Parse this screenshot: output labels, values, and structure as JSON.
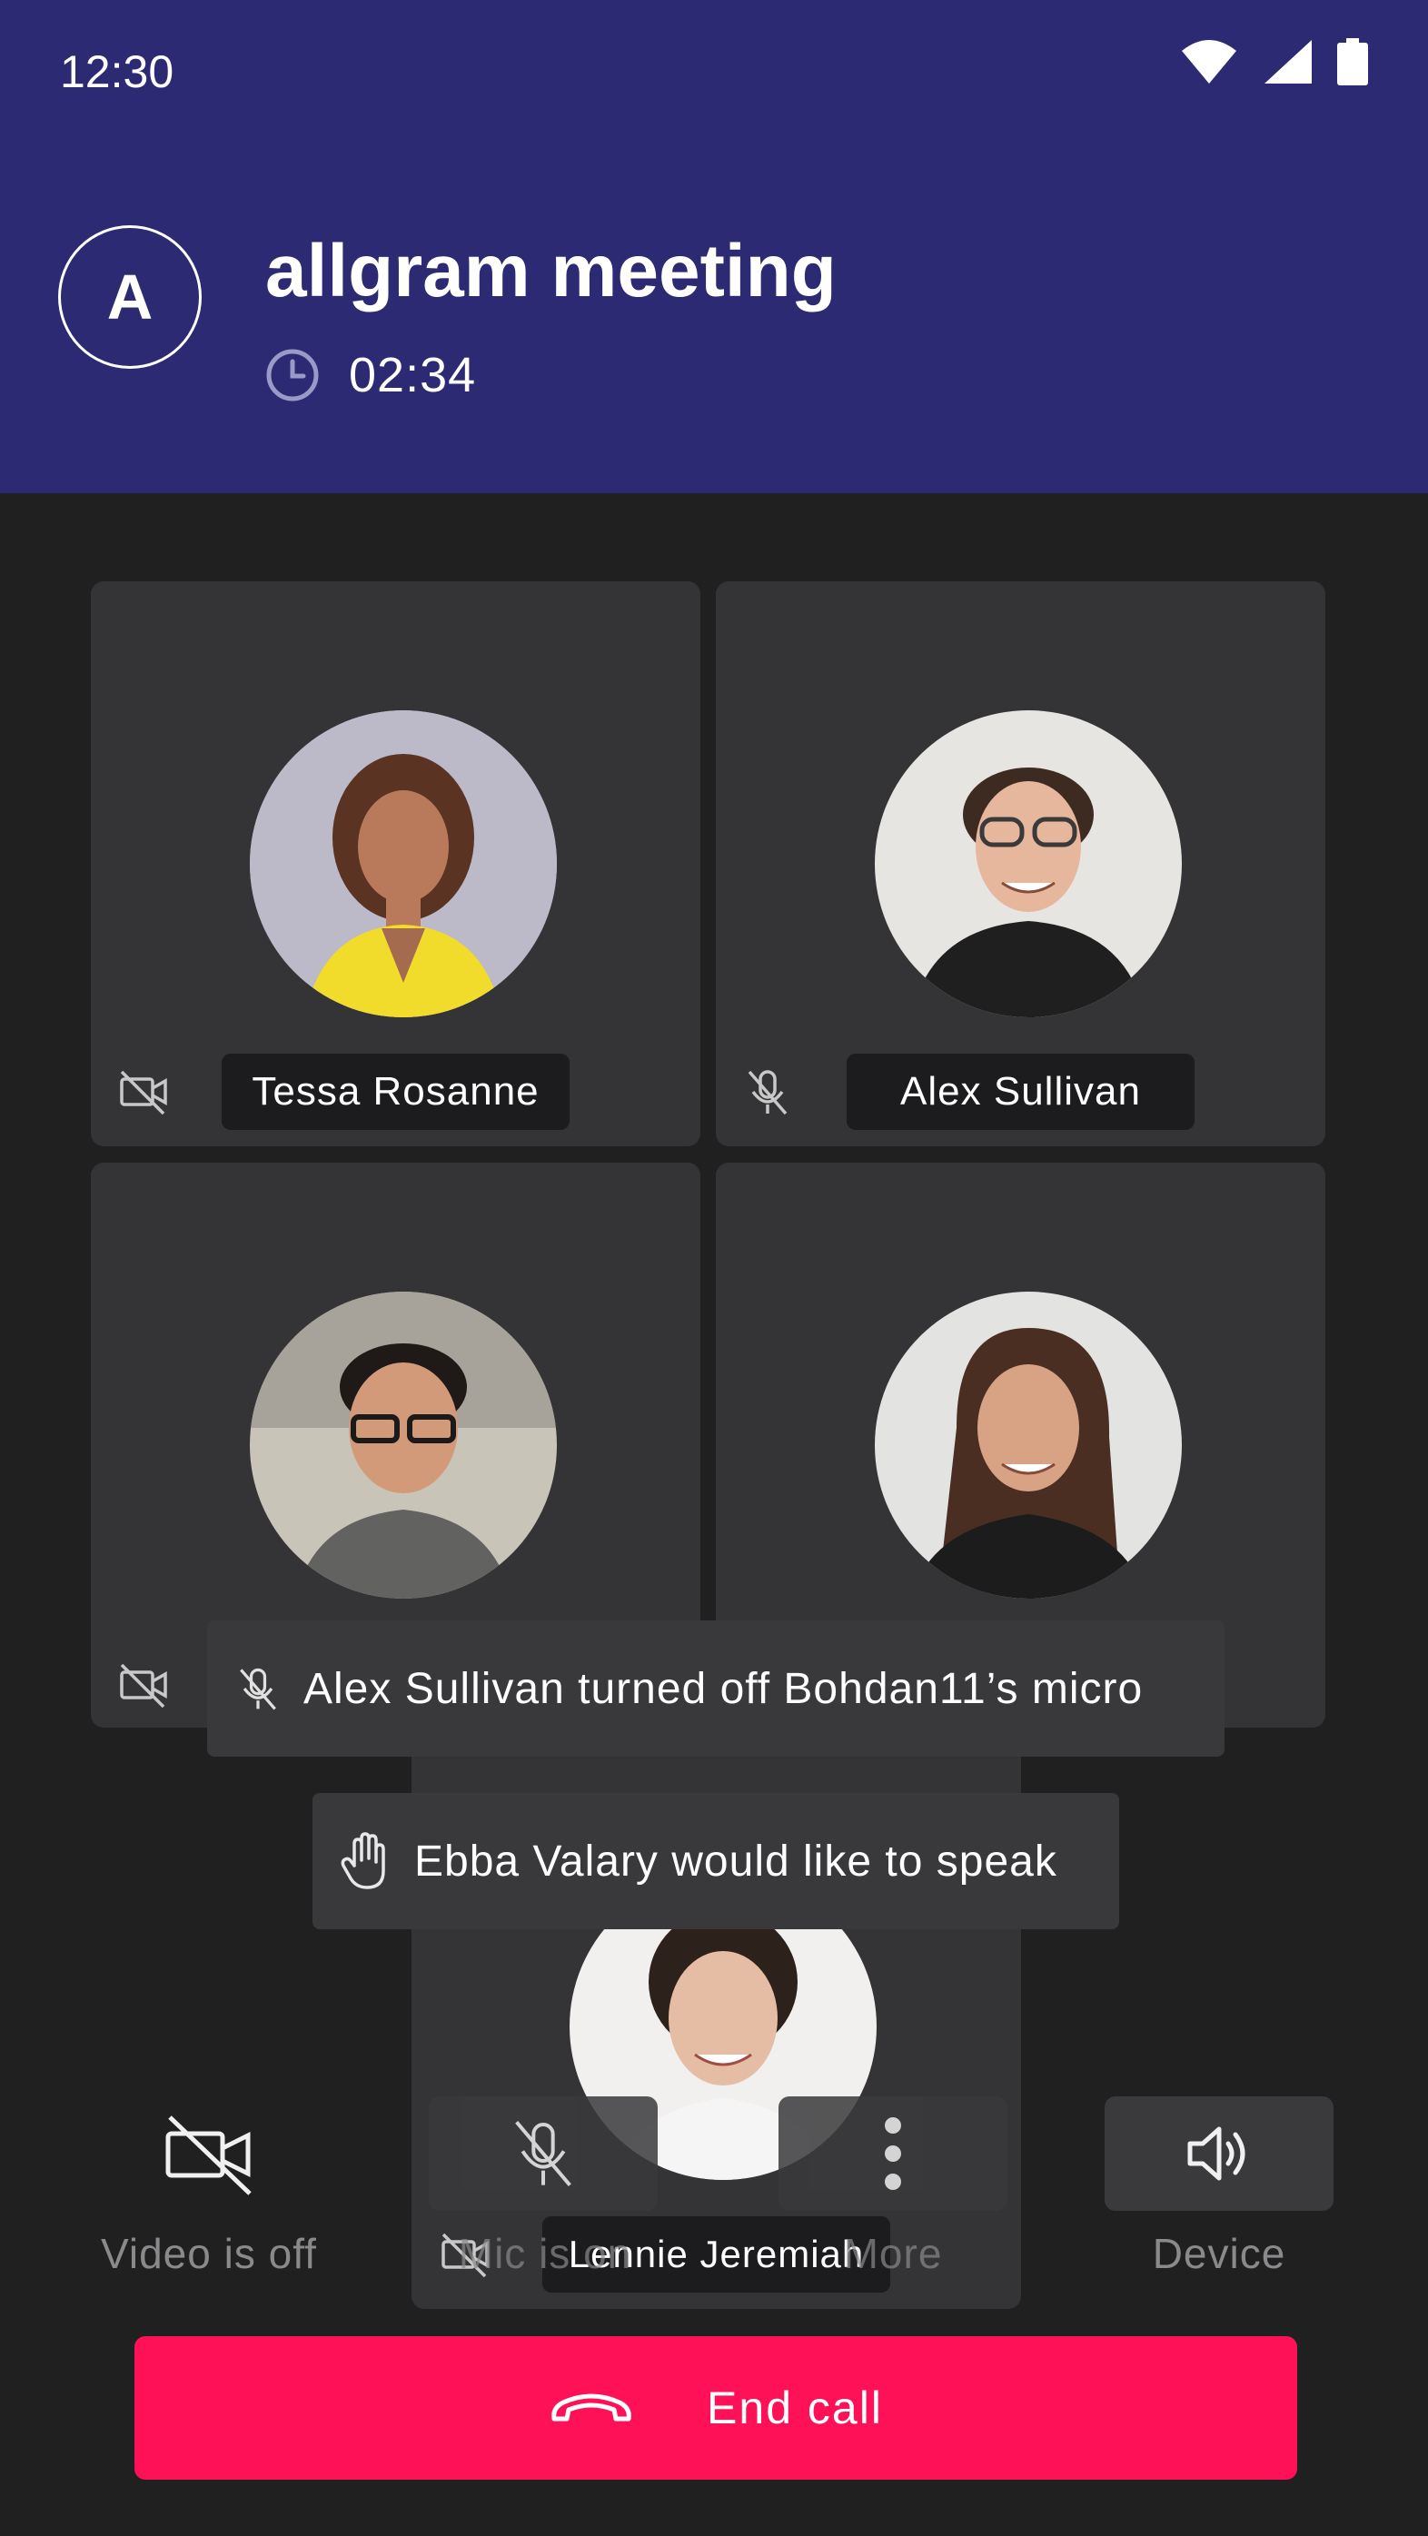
{
  "status_bar": {
    "time": "12:30"
  },
  "header": {
    "avatar_letter": "A",
    "title": "allgram meeting",
    "elapsed": "02:34"
  },
  "participants": [
    {
      "name": "Tessa Rosanne",
      "status_icon": "video-off-icon"
    },
    {
      "name": "Alex Sullivan",
      "status_icon": "mic-off-icon"
    },
    {
      "name": "",
      "status_icon": "video-off-icon"
    },
    {
      "name": "",
      "status_icon": ""
    },
    {
      "name": "Lennie Jeremiah",
      "status_icon": "video-off-icon"
    }
  ],
  "notifications": [
    {
      "icon": "mic-off-icon",
      "text": "Alex Sullivan turned off Bohdan11’s micro"
    },
    {
      "icon": "raised-hand-icon",
      "text": "Ebba Valary would like to speak"
    }
  ],
  "controls": {
    "video_label": "Video is off",
    "mic_label": "Mic is on",
    "more_label": "More",
    "device_label": "Device"
  },
  "end_call_label": "End call",
  "colors": {
    "header_bg": "#2b2a73",
    "background": "#202021",
    "tile_bg": "#343436",
    "end_call": "#ff1157"
  }
}
